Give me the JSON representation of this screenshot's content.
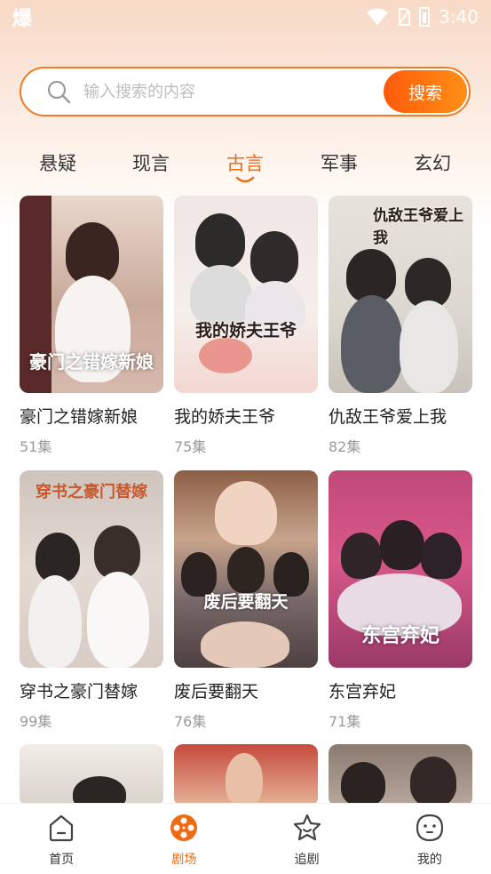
{
  "status_bar": {
    "app_glyph": "爆",
    "time": "3:40"
  },
  "search": {
    "placeholder": "输入搜索的内容",
    "button_label": "搜索"
  },
  "tabs": [
    {
      "label": "悬疑",
      "active": false
    },
    {
      "label": "现言",
      "active": false
    },
    {
      "label": "古言",
      "active": true
    },
    {
      "label": "军事",
      "active": false
    },
    {
      "label": "玄幻",
      "active": false
    }
  ],
  "dramas": [
    {
      "title": "豪门之错嫁新娘",
      "episodes": "51集",
      "poster_text": "豪门之错嫁新娘"
    },
    {
      "title": "我的娇夫王爷",
      "episodes": "75集",
      "poster_text": "我的娇夫王爷"
    },
    {
      "title": "仇敌王爷爱上我",
      "episodes": "82集",
      "poster_text": "仇敌王爷爱上我"
    },
    {
      "title": "穿书之豪门替嫁",
      "episodes": "99集",
      "poster_text": "穿书之豪门替嫁"
    },
    {
      "title": "废后要翻天",
      "episodes": "76集",
      "poster_text": "废后要翻天"
    },
    {
      "title": "东宫弃妃",
      "episodes": "71集",
      "poster_text": "东宫弃妃"
    }
  ],
  "bottom_nav": [
    {
      "label": "首页",
      "icon": "home-icon",
      "active": false
    },
    {
      "label": "剧场",
      "icon": "film-reel-icon",
      "active": true
    },
    {
      "label": "追剧",
      "icon": "star-icon",
      "active": false
    },
    {
      "label": "我的",
      "icon": "face-icon",
      "active": false
    }
  ],
  "colors": {
    "accent": "#f06a12",
    "search_border": "#f07b25",
    "button_gradient_start": "#ff5a0a",
    "button_gradient_end": "#ff9016"
  }
}
